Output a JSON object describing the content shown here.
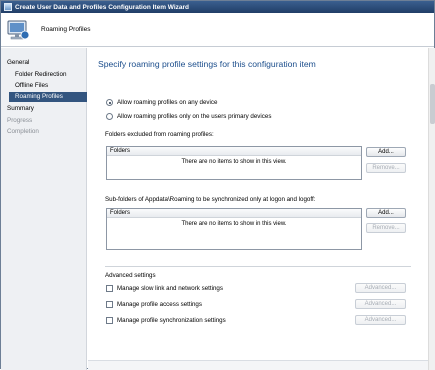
{
  "window": {
    "title": "Create User Data and Profiles Configuration Item Wizard"
  },
  "header": {
    "title": "Roaming Profiles"
  },
  "nav": {
    "items": [
      {
        "label": "General",
        "state": "normal"
      },
      {
        "label": "Folder Redirection",
        "state": "normal"
      },
      {
        "label": "Offline Files",
        "state": "normal"
      },
      {
        "label": "Roaming Profiles",
        "state": "selected"
      },
      {
        "label": "Summary",
        "state": "normal"
      },
      {
        "label": "Progress",
        "state": "disabled"
      },
      {
        "label": "Completion",
        "state": "disabled"
      }
    ]
  },
  "main": {
    "title": "Specify roaming profile settings for this configuration item",
    "radio_options": [
      {
        "label": "Allow roaming profiles on any device",
        "checked": true
      },
      {
        "label": "Allow roaming profiles only on the users primary devices",
        "checked": false
      }
    ],
    "excluded_section": {
      "label": "Folders excluded from roaming profiles:",
      "column": "Folders",
      "empty_text": "There are no items to show in this view.",
      "add": "Add...",
      "remove": "Remove..."
    },
    "subfolder_section": {
      "label": "Sub-folders of Appdata\\Roaming to be synchronized only at logon and logoff:",
      "column": "Folders",
      "empty_text": "There are no items to show in this view.",
      "add": "Add...",
      "remove": "Remove..."
    },
    "advanced": {
      "label": "Advanced settings",
      "options": [
        {
          "label": "Manage slow link and network settings",
          "button": "Advanced..."
        },
        {
          "label": "Manage profile access settings",
          "button": "Advanced..."
        },
        {
          "label": "Manage profile synchronization settings",
          "button": "Advanced..."
        }
      ]
    }
  },
  "colors": {
    "title_bar": "#213e67",
    "accent": "#1c4e8c",
    "selected_nav": "#33557f",
    "nav_background": "#eef0f3"
  }
}
